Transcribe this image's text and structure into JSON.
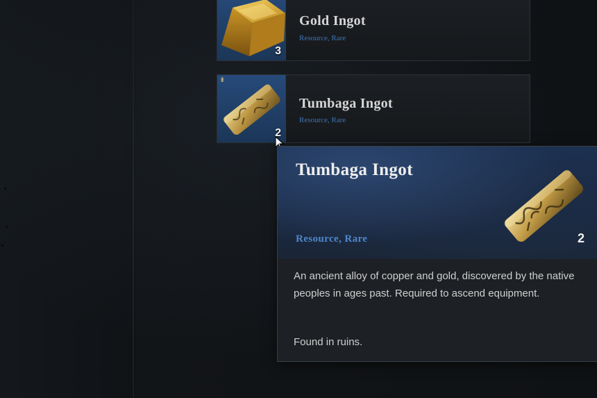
{
  "inventory": {
    "items": [
      {
        "name": "Gold Ingot",
        "category": "Resource, Rare",
        "count": "3",
        "icon": "gold-ingot-icon"
      },
      {
        "name": "Tumbaga Ingot",
        "category": "Resource, Rare",
        "count": "2",
        "icon": "tumbaga-ingot-icon"
      }
    ]
  },
  "tooltip": {
    "title": "Tumbaga Ingot",
    "category": "Resource, Rare",
    "count": "2",
    "icon": "tumbaga-ingot-icon",
    "description": "An ancient alloy of copper and gold, discovered by the native peoples in ages past. Required to ascend equipment.",
    "source": "Found in ruins."
  },
  "colors": {
    "rarity_blue": "#3f73b8",
    "thumb_blue": "#274a7a",
    "gold": "#d4a53a"
  }
}
